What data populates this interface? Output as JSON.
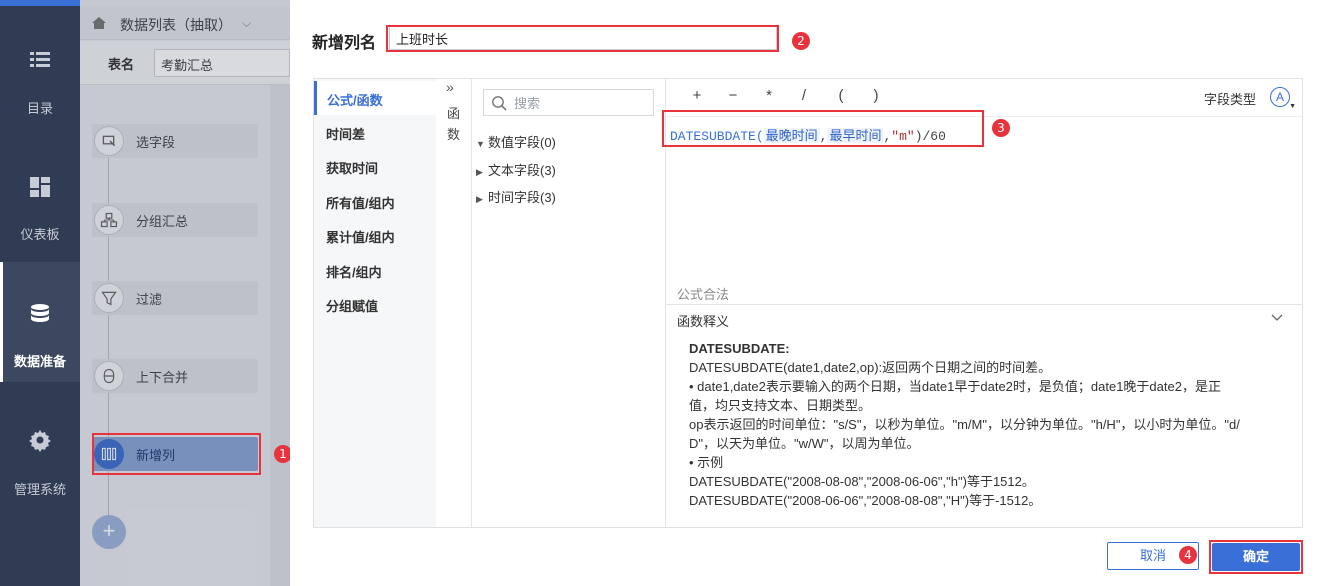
{
  "leftnav": {
    "items": [
      {
        "label": "目录",
        "icon": "list-icon"
      },
      {
        "label": "仪表板",
        "icon": "dashboard-icon"
      },
      {
        "label": "数据准备",
        "icon": "database-icon"
      },
      {
        "label": "管理系统",
        "icon": "gear-icon"
      }
    ]
  },
  "bg": {
    "tab_label": "数据列表（抽取）",
    "name_label": "表名",
    "name_value": "考勤汇总",
    "steps": [
      {
        "label": "选字段"
      },
      {
        "label": "分组汇总"
      },
      {
        "label": "过滤"
      },
      {
        "label": "上下合并"
      },
      {
        "label": "新增列"
      }
    ],
    "add_label": "+"
  },
  "dialog": {
    "title": "新增列名",
    "name_value": "上班时长",
    "categories": [
      "公式/函数",
      "时间差",
      "获取时间",
      "所有值/组内",
      "累计值/组内",
      "排名/组内",
      "分组赋值"
    ],
    "func_label": "函数",
    "collapse_glyph": "»",
    "search_placeholder": "搜索",
    "tree": [
      {
        "label": "数值字段(0)",
        "expanded": true
      },
      {
        "label": "文本字段(3)",
        "expanded": false
      },
      {
        "label": "时间字段(3)",
        "expanded": false
      }
    ],
    "operators": [
      "+",
      "−",
      "*",
      "/",
      "(",
      ")"
    ],
    "field_type_label": "字段类型",
    "field_type_icon": "Ⓐ",
    "formula": {
      "func": "DATESUBDATE(",
      "field1": "最晚时间",
      "comma1": ",",
      "field2": "最早时间",
      "comma2": ",",
      "arg": "\"m\"",
      "tail": ")/60"
    },
    "validity": "公式合法",
    "explain_title": "函数释义",
    "explain_lines": [
      "DATESUBDATE:",
      "DATESUBDATE(date1,date2,op):返回两个日期之间的时间差。",
      "• date1,date2表示要输入的两个日期，当date1早于date2时，是负值；date1晚于date2，是正",
      "值，均只支持文本、日期类型。",
      "op表示返回的时间单位：\"s/S\"，以秒为单位。\"m/M\"，以分钟为单位。\"h/H\"，以小时为单位。\"d/",
      "D\"，以天为单位。\"w/W\"，以周为单位。",
      "• 示例",
      "DATESUBDATE(\"2008-08-08\",\"2008-06-06\",\"h\")等于1512。",
      "DATESUBDATE(\"2008-06-06\",\"2008-08-08\",\"H\")等于-1512。"
    ],
    "cancel_label": "取消",
    "ok_label": "确定"
  },
  "annotations": [
    "1",
    "2",
    "3",
    "4"
  ],
  "colors": {
    "accent": "#3a6fd8",
    "highlight": "#e8323c",
    "nav_bg": "#2f3c53"
  }
}
